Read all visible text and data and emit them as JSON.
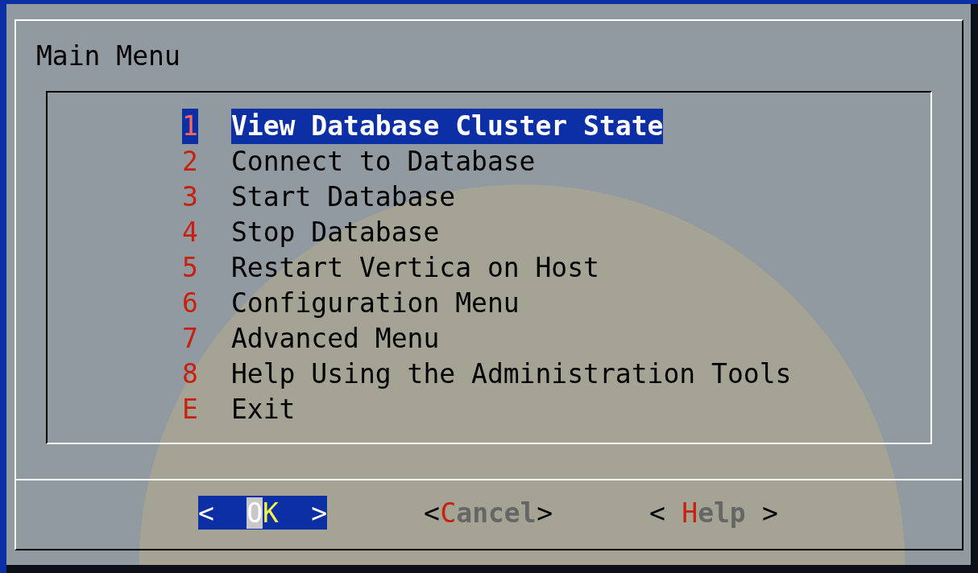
{
  "dialog": {
    "title": "Main Menu",
    "items": [
      {
        "tag": "1",
        "label": "View Database Cluster State",
        "selected": true
      },
      {
        "tag": "2",
        "label": "Connect to Database",
        "selected": false
      },
      {
        "tag": "3",
        "label": "Start Database",
        "selected": false
      },
      {
        "tag": "4",
        "label": "Stop Database",
        "selected": false
      },
      {
        "tag": "5",
        "label": "Restart Vertica on Host",
        "selected": false
      },
      {
        "tag": "6",
        "label": "Configuration Menu",
        "selected": false
      },
      {
        "tag": "7",
        "label": "Advanced Menu",
        "selected": false
      },
      {
        "tag": "8",
        "label": "Help Using the Administration Tools",
        "selected": false
      },
      {
        "tag": "E",
        "label": "Exit",
        "selected": false
      }
    ],
    "buttons": [
      {
        "left": "<",
        "hotkey": "O",
        "rest": "K",
        "right": ">",
        "selected": true
      },
      {
        "left": "<",
        "hotkey": "C",
        "rest": "ancel",
        "right": ">",
        "selected": false
      },
      {
        "left": "<",
        "hotkey": "H",
        "rest": "elp",
        "right": ">",
        "selected": false
      }
    ]
  }
}
